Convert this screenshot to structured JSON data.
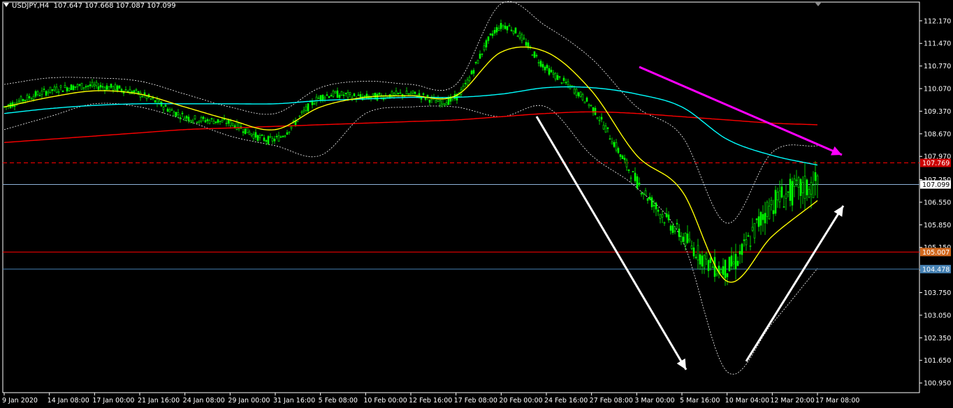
{
  "window": {
    "symbol": "USDJPY,H4",
    "ohlc": "107.647 107.668 107.087 107.099"
  },
  "colors": {
    "background": "#000000",
    "candle": "#00ff00",
    "ma_fast": "#ffff00",
    "ma_mid": "#00ffff",
    "ma_slow": "#ff0000",
    "bands": "#ffffff",
    "level_red": "#ff0000",
    "level_orange": "#d2691e",
    "level_blue": "#4682b4",
    "level_current": "#ffffff",
    "arrow_magenta": "#ff00ff",
    "arrow_white": "#ffffff"
  },
  "chart_data": {
    "type": "line",
    "title": "USDJPY,H4",
    "ylim": [
      100.65,
      112.75
    ],
    "grid": false,
    "price_ticks": [
      "112.170",
      "111.470",
      "110.770",
      "110.070",
      "109.370",
      "108.670",
      "107.970",
      "107.250",
      "106.550",
      "105.850",
      "105.150",
      "104.450",
      "103.750",
      "103.050",
      "102.350",
      "101.650",
      "100.950"
    ],
    "time_ticks": [
      "9 Jan 2020",
      "14 Jan 08:00",
      "17 Jan 00:00",
      "21 Jan 16:00",
      "24 Jan 08:00",
      "29 Jan 00:00",
      "31 Jan 16:00",
      "5 Feb 08:00",
      "10 Feb 00:00",
      "12 Feb 16:00",
      "17 Feb 08:00",
      "20 Feb 00:00",
      "24 Feb 16:00",
      "27 Feb 08:00",
      "3 Mar 00:00",
      "5 Mar 16:00",
      "10 Mar 04:00",
      "12 Mar 20:00",
      "17 Mar 08:00"
    ],
    "price_path": [
      {
        "t": "9 Jan 2020",
        "v": 109.5
      },
      {
        "t": "14 Jan 08:00",
        "v": 110.0
      },
      {
        "t": "17 Jan 00:00",
        "v": 110.15
      },
      {
        "t": "21 Jan 16:00",
        "v": 109.9
      },
      {
        "t": "24 Jan 08:00",
        "v": 109.2
      },
      {
        "t": "29 Jan 00:00",
        "v": 109.0
      },
      {
        "t": "31 Jan 16:00",
        "v": 108.5
      },
      {
        "t": "5 Feb 08:00",
        "v": 109.8
      },
      {
        "t": "10 Feb 00:00",
        "v": 109.8
      },
      {
        "t": "12 Feb 16:00",
        "v": 109.9
      },
      {
        "t": "17 Feb 08:00",
        "v": 109.8
      },
      {
        "t": "20 Feb 00:00",
        "v": 112.0
      },
      {
        "t": "24 Feb 16:00",
        "v": 110.7
      },
      {
        "t": "27 Feb 08:00",
        "v": 109.5
      },
      {
        "t": "3 Mar 00:00",
        "v": 107.2
      },
      {
        "t": "5 Mar 16:00",
        "v": 105.5
      },
      {
        "t": "10 Mar 04:00",
        "v": 104.5
      },
      {
        "t": "12 Mar 20:00",
        "v": 106.5
      },
      {
        "t": "17 Mar 08:00",
        "v": 107.1
      }
    ],
    "series": [
      {
        "values": [
          109.5,
          109.8,
          110.0,
          109.9,
          109.5,
          109.1,
          108.8,
          109.5,
          109.8,
          109.85,
          109.85,
          111.2,
          111.2,
          110.0,
          108.0,
          106.9,
          104.1,
          105.5,
          106.6
        ]
      },
      {
        "values": [
          109.3,
          109.45,
          109.55,
          109.6,
          109.6,
          109.6,
          109.6,
          109.7,
          109.75,
          109.8,
          109.8,
          109.9,
          110.1,
          110.1,
          109.9,
          109.5,
          108.5,
          108.0,
          107.7
        ]
      },
      {
        "values": [
          108.4,
          108.5,
          108.6,
          108.7,
          108.8,
          108.85,
          108.9,
          108.95,
          109.0,
          109.05,
          109.1,
          109.2,
          109.3,
          109.35,
          109.3,
          109.2,
          109.1,
          109.0,
          108.95
        ]
      }
    ],
    "bollinger_upper": [
      110.2,
      110.4,
      110.4,
      110.3,
      109.9,
      109.5,
      109.3,
      110.1,
      110.3,
      110.2,
      110.2,
      112.7,
      112.0,
      111.0,
      109.5,
      108.6,
      105.9,
      108.1,
      108.3
    ],
    "bollinger_lower": [
      108.8,
      109.2,
      109.6,
      109.5,
      109.1,
      108.6,
      108.3,
      108.0,
      109.3,
      109.5,
      109.5,
      109.2,
      109.5,
      108.0,
      107.0,
      105.4,
      101.3,
      102.8,
      104.5
    ],
    "levels": [
      {
        "price": 107.769,
        "label": "107.769"
      },
      {
        "price": 107.099,
        "label": "107.099"
      },
      {
        "price": 105.007,
        "label": "105.007"
      },
      {
        "price": 104.478,
        "label": "104.478"
      }
    ]
  }
}
